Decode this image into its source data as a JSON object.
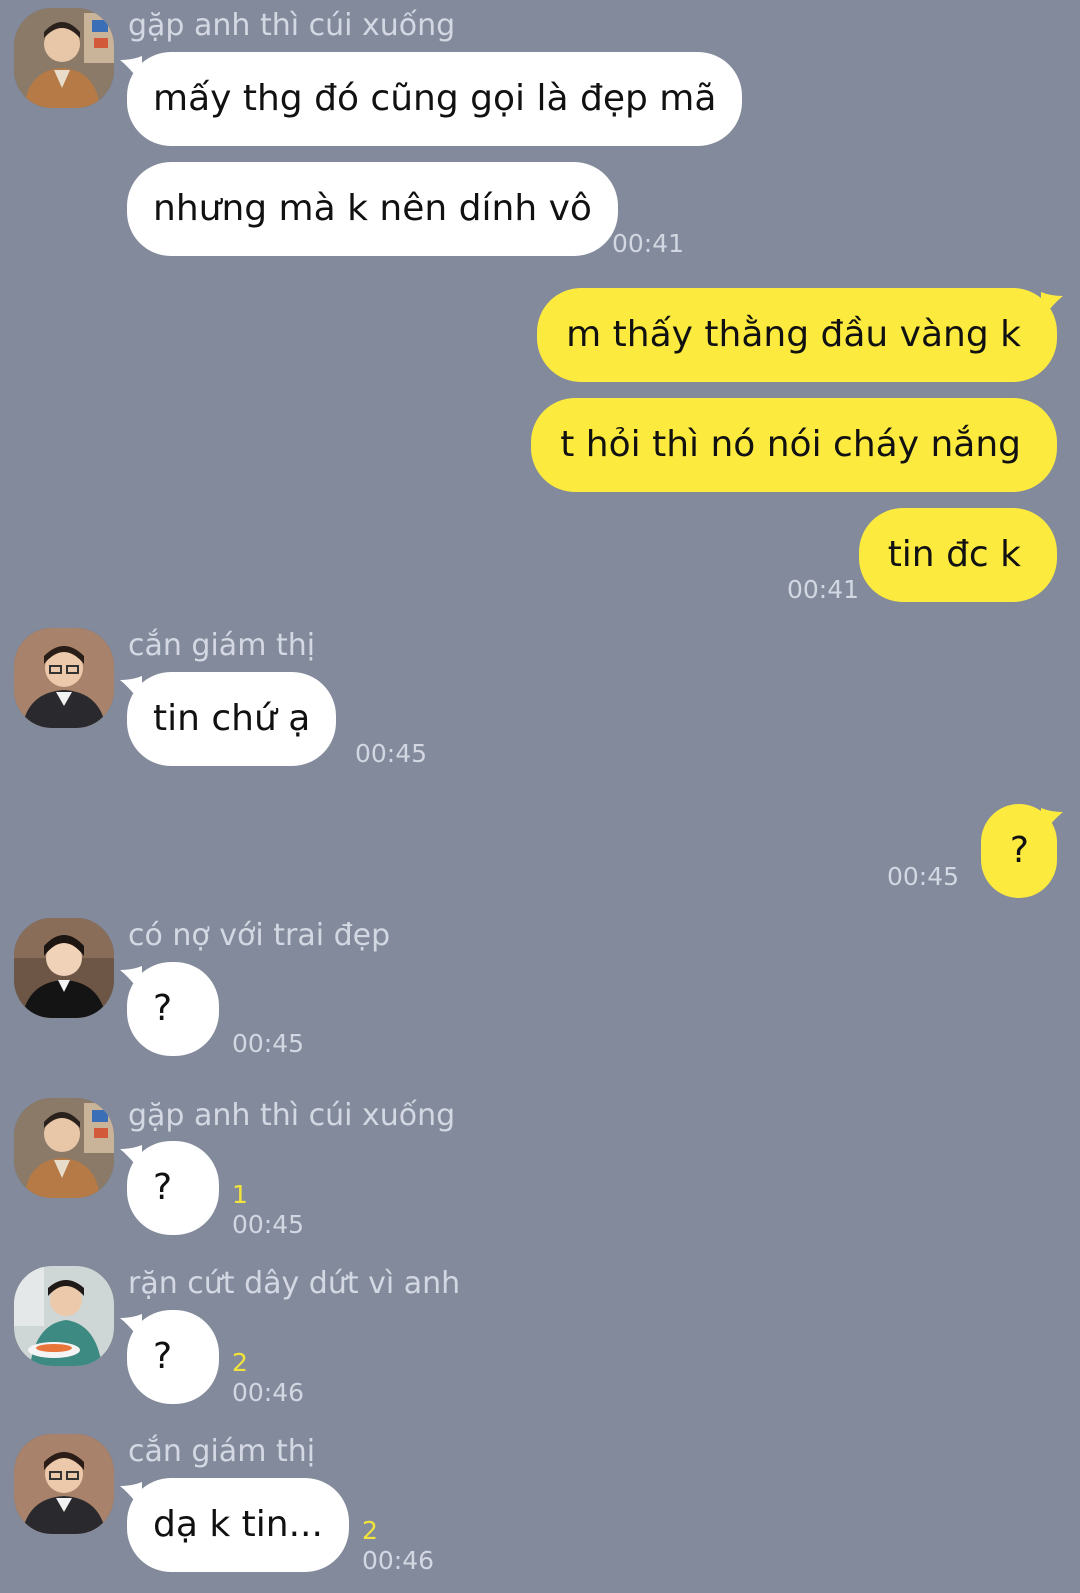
{
  "users": {
    "u1": "gặp anh thì cúi xuống",
    "u2": "cắn giám thị",
    "u3": "có nợ với trai đẹp",
    "u4": "rặn cứt dây dứt vì anh"
  },
  "messages": [
    {
      "text": "mấy thg đó cũng gọi là đẹp mã"
    },
    {
      "text": "nhưng mà k nên dính vô",
      "time": "00:41"
    },
    {
      "text": "m thấy thằng đầu vàng k"
    },
    {
      "text": "t hỏi thì nó nói cháy nắng"
    },
    {
      "text": "tin đc k",
      "time": "00:41"
    },
    {
      "text": "tin chứ ạ",
      "time": "00:45"
    },
    {
      "text": "?",
      "time": "00:45"
    },
    {
      "text": "?",
      "time": "00:45"
    },
    {
      "text": "?",
      "time": "00:45",
      "unread": "1"
    },
    {
      "text": "?",
      "time": "00:46",
      "unread": "2"
    },
    {
      "text": "dạ k tin...",
      "time": "00:46",
      "unread": "2"
    }
  ],
  "colors": {
    "background": "#828a9c",
    "incoming_bubble": "#ffffff",
    "outgoing_bubble": "#fceb3e",
    "unread_count": "#f2e43a"
  }
}
